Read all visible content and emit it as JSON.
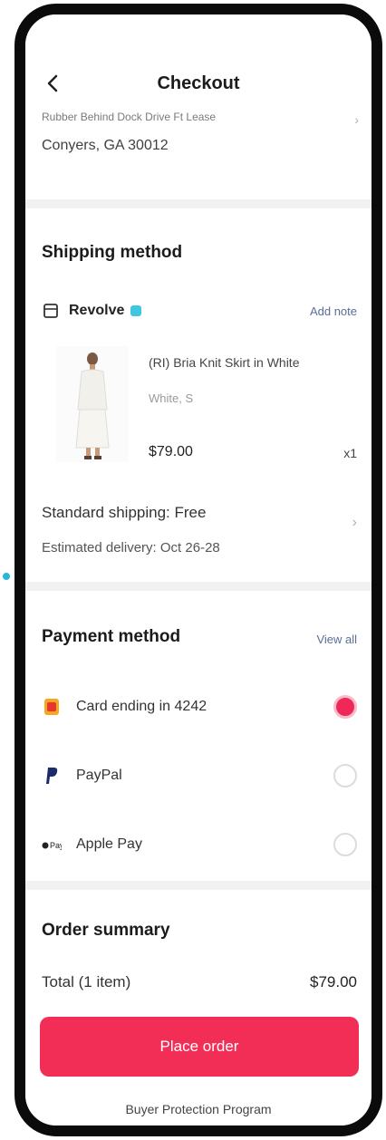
{
  "header": {
    "title": "Checkout"
  },
  "address": {
    "line1": "Rubber Behind Dock Drive Ft Lease",
    "line2": "Conyers, GA 30012"
  },
  "shipping": {
    "section_title": "Shipping method",
    "store_name": "Revolve",
    "add_note": "Add note",
    "product_name": "(RI) Bria Knit Skirt in White",
    "product_variant": "White, S",
    "product_price": "$79.00",
    "product_qty": "x1",
    "method_line": "Standard shipping: Free",
    "delivery_line": "Estimated delivery: Oct 26-28"
  },
  "payment": {
    "section_title": "Payment method",
    "view_all": "View all",
    "options": [
      {
        "label": "Card ending in 4242",
        "selected": true,
        "icon": "card-icon"
      },
      {
        "label": "PayPal",
        "selected": false,
        "icon": "paypal-icon"
      },
      {
        "label": "Apple Pay",
        "selected": false,
        "icon": "apple-pay-icon"
      }
    ]
  },
  "summary": {
    "section_title": "Order summary",
    "total_label": "Total (1 item)",
    "total_value": "$79.00"
  },
  "actions": {
    "place_order": "Place order",
    "buyer_protection": "Buyer Protection Program"
  },
  "colors": {
    "accent": "#f22e57",
    "link": "#5a6e96",
    "divider": "#f1f1f1"
  }
}
